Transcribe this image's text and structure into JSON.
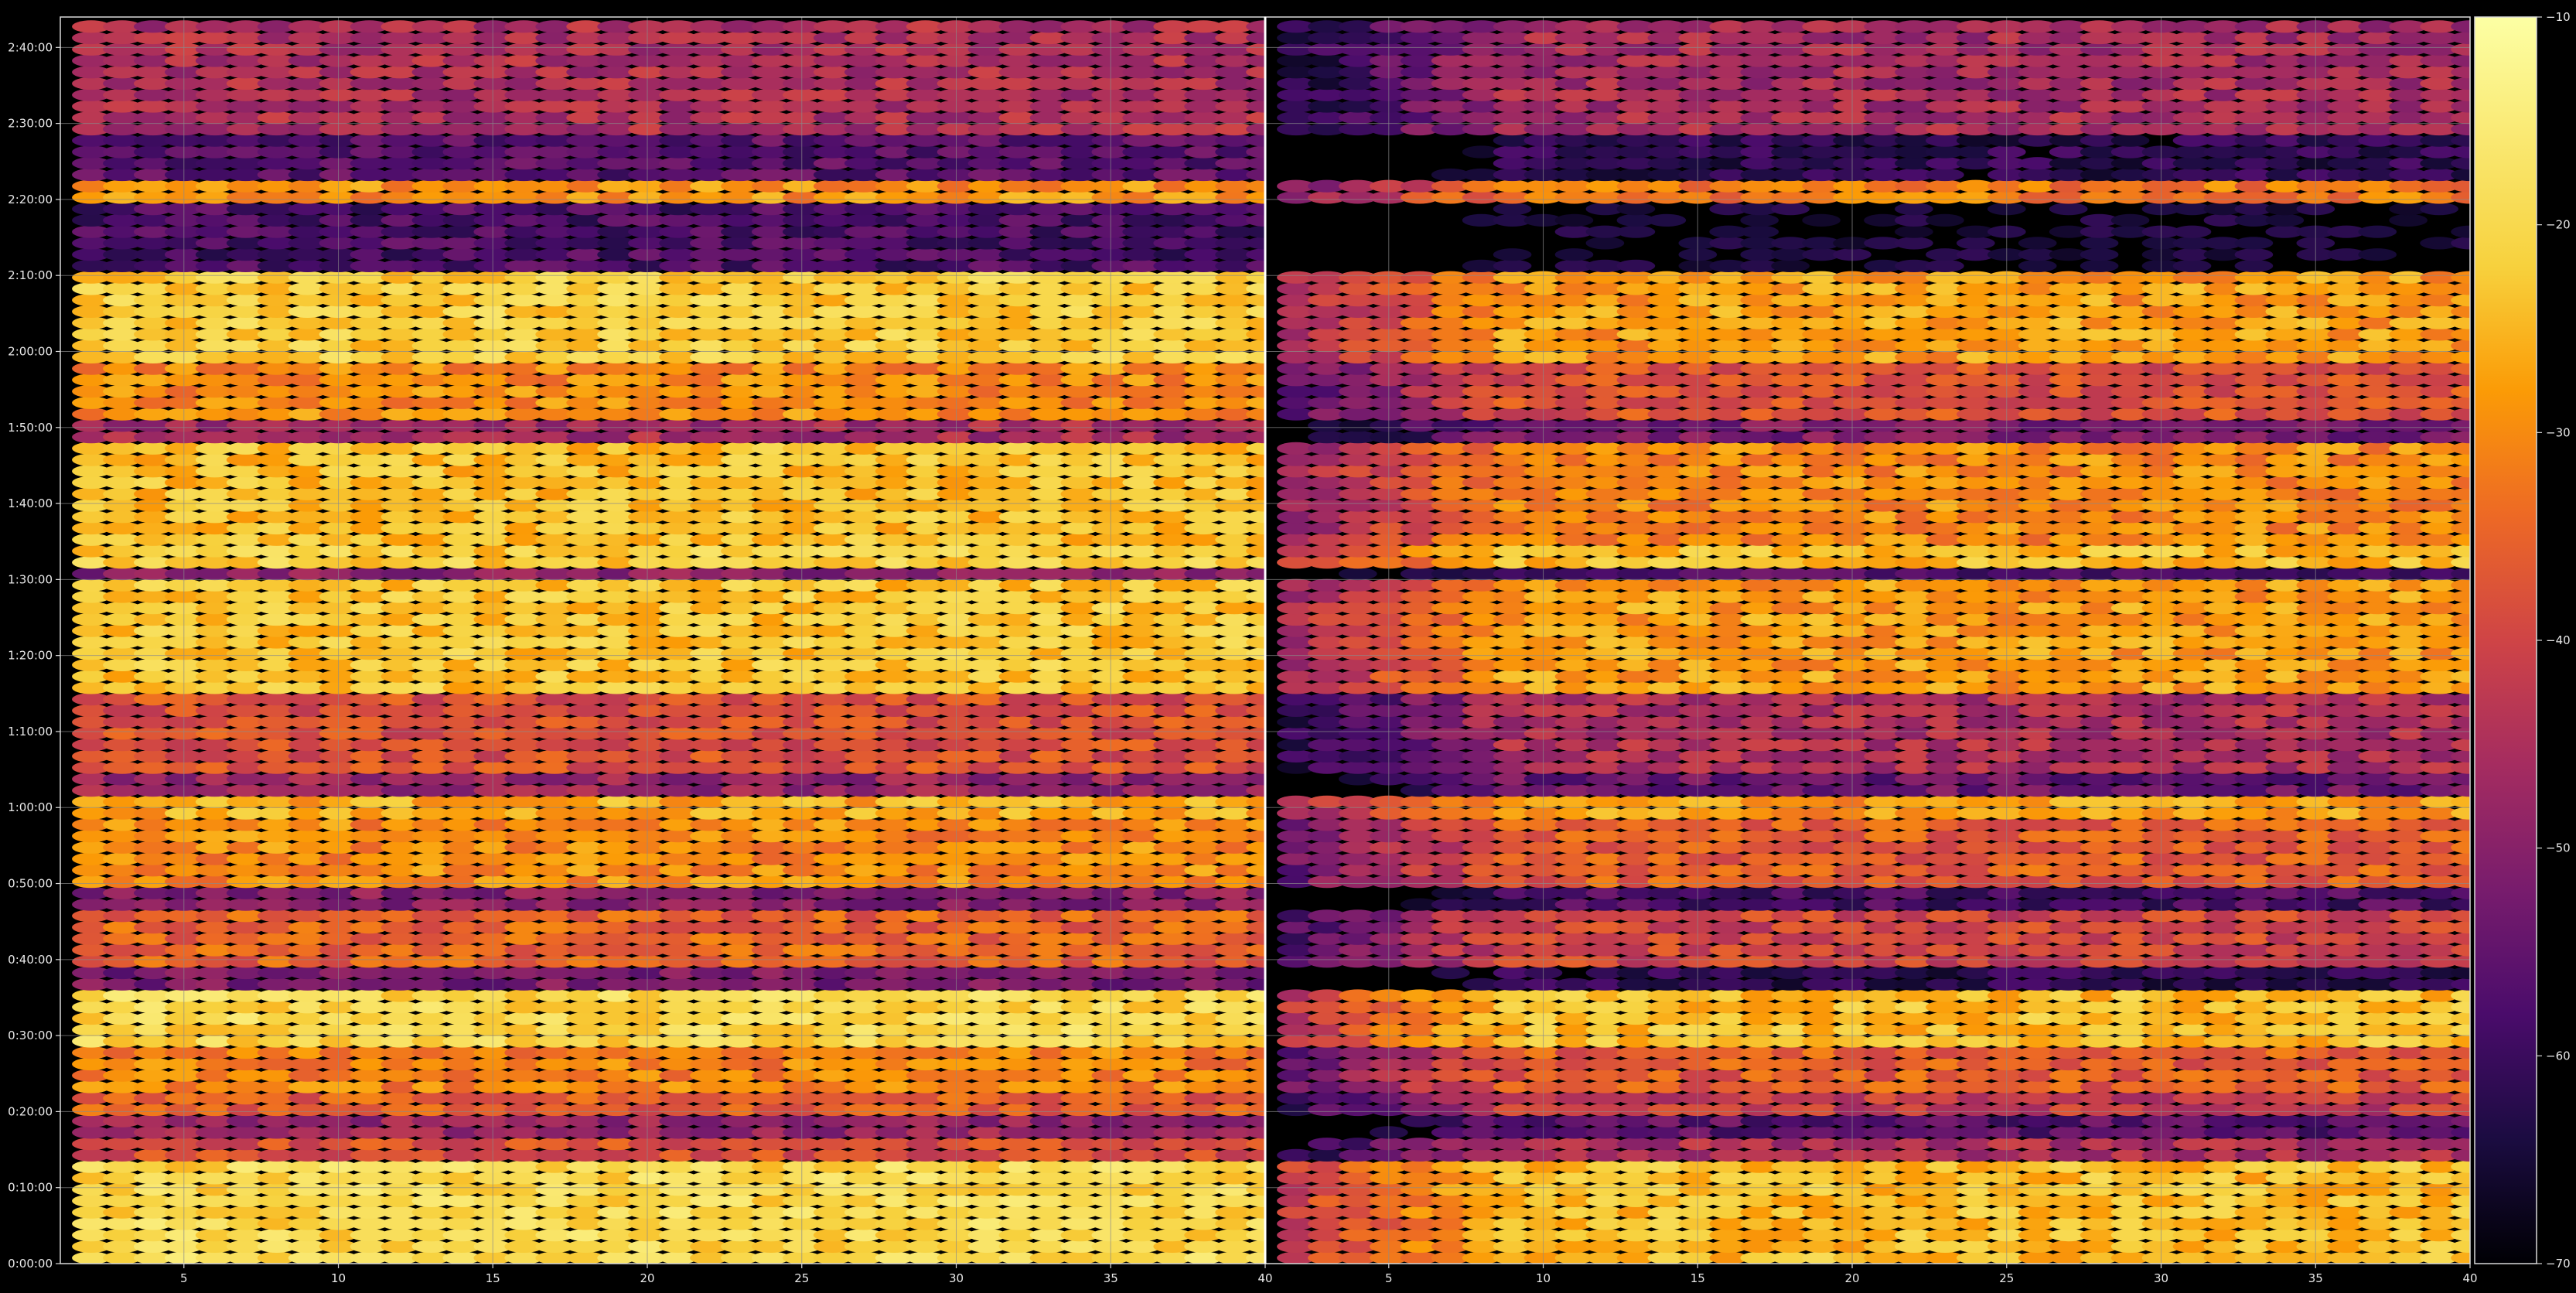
{
  "figure": {
    "background": "#000000",
    "axis_color": "#d9d9d9",
    "grid_color": "#8a8a8a",
    "colormap": "inferno"
  },
  "chart_data": {
    "type": "heatmap",
    "title": "",
    "xlabel": "",
    "ylabel": "",
    "grid": true,
    "colormap": "inferno",
    "panels": [
      {
        "name": "",
        "xlim": [
          1,
          40
        ],
        "x_tick_values": [
          5,
          10,
          15,
          20,
          25,
          30,
          35,
          40
        ],
        "x_tick_labels": [
          "5",
          "10",
          "15",
          "20",
          "25",
          "30",
          "35",
          "40"
        ],
        "x_columns": [
          2,
          40
        ]
      },
      {
        "name": "",
        "xlim": [
          1,
          40
        ],
        "x_tick_values": [
          5,
          10,
          15,
          20,
          25,
          30,
          35,
          40
        ],
        "x_tick_labels": [
          "5",
          "10",
          "15",
          "20",
          "25",
          "30",
          "35",
          "40"
        ],
        "x_columns": [
          2,
          40
        ]
      }
    ],
    "y_axis": {
      "unit": "minutes",
      "ylim": [
        0,
        164
      ],
      "tick_values": [
        0,
        10,
        20,
        30,
        40,
        50,
        60,
        70,
        80,
        90,
        100,
        110,
        120,
        130,
        140,
        150,
        160
      ],
      "tick_labels": [
        "0:00:00",
        "0:10:00",
        "0:20:00",
        "0:30:00",
        "0:40:00",
        "0:50:00",
        "1:00:00",
        "1:10:00",
        "1:20:00",
        "1:30:00",
        "1:40:00",
        "1:50:00",
        "2:00:00",
        "2:10:00",
        "2:20:00",
        "2:30:00",
        "2:40:00"
      ]
    },
    "colorbar": {
      "vmin": -70,
      "vmax": -10,
      "tick_values": [
        -70,
        -60,
        -50,
        -40,
        -30,
        -20,
        -10
      ],
      "tick_labels": [
        "−70",
        "−60",
        "−50",
        "−40",
        "−30",
        "−20",
        "−10"
      ]
    },
    "row_step_minutes": 1.5,
    "row_profile_db": [
      {
        "from": 0,
        "to": 13,
        "left": -20,
        "right": -24
      },
      {
        "from": 13,
        "to": 17,
        "left": -38,
        "right": -45
      },
      {
        "from": 17,
        "to": 19,
        "left": -48,
        "right": -56
      },
      {
        "from": 19,
        "to": 22,
        "left": -36,
        "right": -42
      },
      {
        "from": 22,
        "to": 23,
        "left": -27,
        "right": -30
      },
      {
        "from": 23,
        "to": 28,
        "left": -31,
        "right": -36
      },
      {
        "from": 28,
        "to": 36,
        "left": -20,
        "right": -24
      },
      {
        "from": 36,
        "to": 39,
        "left": -52,
        "right": -62
      },
      {
        "from": 39,
        "to": 47,
        "left": -35,
        "right": -40
      },
      {
        "from": 47,
        "to": 50,
        "left": -50,
        "right": -58
      },
      {
        "from": 50,
        "to": 58,
        "left": -30,
        "right": -36
      },
      {
        "from": 58,
        "to": 61,
        "left": -26,
        "right": -28
      },
      {
        "from": 61,
        "to": 64,
        "left": -48,
        "right": -54
      },
      {
        "from": 64,
        "to": 75,
        "left": -38,
        "right": -45
      },
      {
        "from": 75,
        "to": 90,
        "left": -23,
        "right": -28
      },
      {
        "from": 90,
        "to": 92,
        "left": -50,
        "right": -57
      },
      {
        "from": 92,
        "to": 95,
        "left": -22,
        "right": -24
      },
      {
        "from": 95,
        "to": 108,
        "left": -24,
        "right": -30
      },
      {
        "from": 108,
        "to": 111,
        "left": -46,
        "right": -52
      },
      {
        "from": 111,
        "to": 119,
        "left": -30,
        "right": -38
      },
      {
        "from": 119,
        "to": 131,
        "left": -22,
        "right": -28
      },
      {
        "from": 131,
        "to": 140,
        "left": -58,
        "right": -66
      },
      {
        "from": 140,
        "to": 142,
        "left": -29,
        "right": -32
      },
      {
        "from": 142,
        "to": 148,
        "left": -56,
        "right": -62
      },
      {
        "from": 148,
        "to": 164,
        "left": -45,
        "right": -46
      }
    ]
  }
}
